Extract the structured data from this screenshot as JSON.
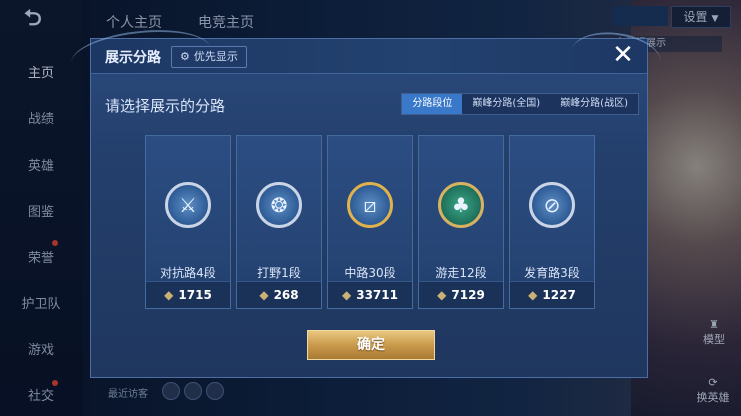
{
  "sidebar": {
    "items": [
      {
        "label": "主页"
      },
      {
        "label": "战绩"
      },
      {
        "label": "英雄"
      },
      {
        "label": "图鉴"
      },
      {
        "label": "荣誉"
      },
      {
        "label": "护卫队"
      },
      {
        "label": "游戏"
      },
      {
        "label": "社交"
      }
    ]
  },
  "header": {
    "tabs": [
      "个人主页",
      "电竞主页"
    ],
    "settings_label": "设置",
    "notice_text": "和数据展示"
  },
  "background": {
    "bottom_text": "最近访客",
    "right_labels": [
      "模型",
      "换英雄"
    ]
  },
  "modal": {
    "title": "展示分路",
    "pref_label": "优先显示",
    "close_label": "✕",
    "subtitle": "请选择展示的分路",
    "segments": [
      {
        "label": "分路段位",
        "active": true
      },
      {
        "label": "巅峰分路(全国)",
        "active": false
      },
      {
        "label": "巅峰分路(战区)",
        "active": false
      }
    ],
    "cards": [
      {
        "label": "对抗路4段",
        "points": "1715",
        "icon": "clash-lane-badge-icon"
      },
      {
        "label": "打野1段",
        "points": "268",
        "icon": "jungle-badge-icon"
      },
      {
        "label": "中路30段",
        "points": "33711",
        "icon": "mid-lane-badge-icon"
      },
      {
        "label": "游走12段",
        "points": "7129",
        "icon": "roam-badge-icon"
      },
      {
        "label": "发育路3段",
        "points": "1227",
        "icon": "farm-lane-badge-icon"
      }
    ],
    "confirm_label": "确定"
  },
  "colors": {
    "accent": "#3a78c9",
    "gold": "#c99a4c",
    "panel": "#243f6c"
  }
}
